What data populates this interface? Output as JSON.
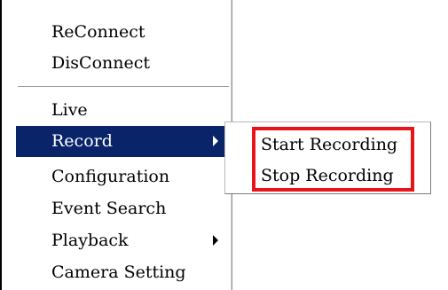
{
  "menu": {
    "items": [
      {
        "label": "ReConnect"
      },
      {
        "label": "DisConnect"
      },
      {
        "label": "Live"
      },
      {
        "label": "Record",
        "has_submenu": true,
        "highlighted": true
      },
      {
        "label": "Configuration"
      },
      {
        "label": "Event Search"
      },
      {
        "label": "Playback",
        "has_submenu": true
      },
      {
        "label": "Camera Setting"
      }
    ],
    "highlight_color": "#0a246a"
  },
  "submenu": {
    "items": [
      {
        "label": "Start Recording"
      },
      {
        "label": "Stop Recording"
      }
    ],
    "annotation_color": "#e8141a"
  }
}
